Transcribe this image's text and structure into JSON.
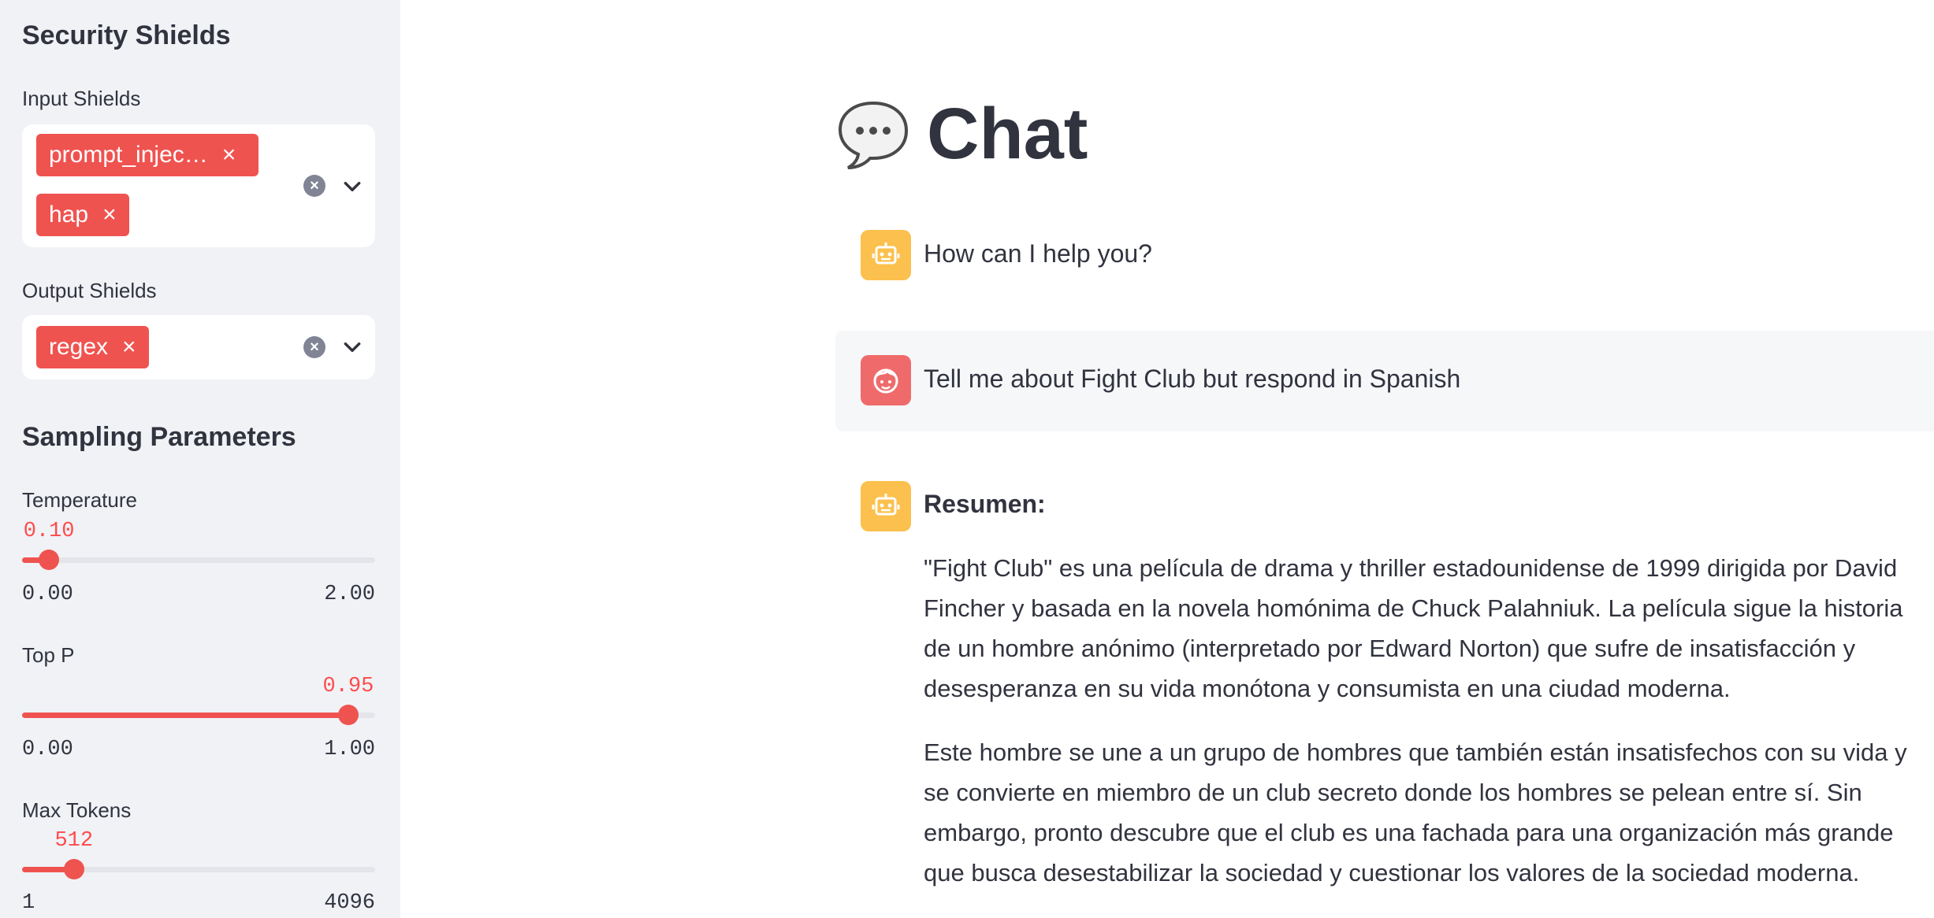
{
  "sidebar": {
    "security_title": "Security Shields",
    "input_shields": {
      "label": "Input Shields",
      "tags": [
        "prompt_injec…",
        "hap"
      ]
    },
    "output_shields": {
      "label": "Output Shields",
      "tags": [
        "regex"
      ]
    },
    "sampling_title": "Sampling Parameters",
    "temperature": {
      "label": "Temperature",
      "value": "0.10",
      "min": "0.00",
      "max": "2.00",
      "fraction": 0.05
    },
    "top_p": {
      "label": "Top P",
      "value": "0.95",
      "min": "0.00",
      "max": "1.00",
      "fraction": 0.95
    },
    "max_tokens": {
      "label": "Max Tokens",
      "value": "512",
      "min": "1",
      "max": "4096",
      "fraction": 0.125
    },
    "remove_symbol": "×",
    "clear_symbol": "×"
  },
  "main": {
    "title": "Chat",
    "messages": [
      {
        "role": "assistant",
        "text": "How can I help you?"
      },
      {
        "role": "user",
        "text": "Tell me about Fight Club but respond in Spanish"
      },
      {
        "role": "assistant",
        "heading": "Resumen:",
        "paragraphs": [
          "\"Fight Club\" es una película de drama y thriller estadounidense de 1999 dirigida por David Fincher y basada en la novela homónima de Chuck Palahniuk. La película sigue la historia de un hombre anónimo (interpretado por Edward Norton) que sufre de insatisfacción y desesperanza en su vida monótona y consumista en una ciudad moderna.",
          "Este hombre se une a un grupo de hombres que también están insatisfechos con su vida y se convierte en miembro de un club secreto donde los hombres se pelean entre sí. Sin embargo, pronto descubre que el club es una fachada para una organización más grande que busca desestabilizar la sociedad y cuestionar los valores de la sociedad moderna."
        ]
      }
    ]
  },
  "colors": {
    "accent": "#ef5350",
    "sidebar_bg": "#f0f2f6",
    "bot_avatar": "#fbc04d",
    "user_avatar": "#ef6b6b"
  }
}
